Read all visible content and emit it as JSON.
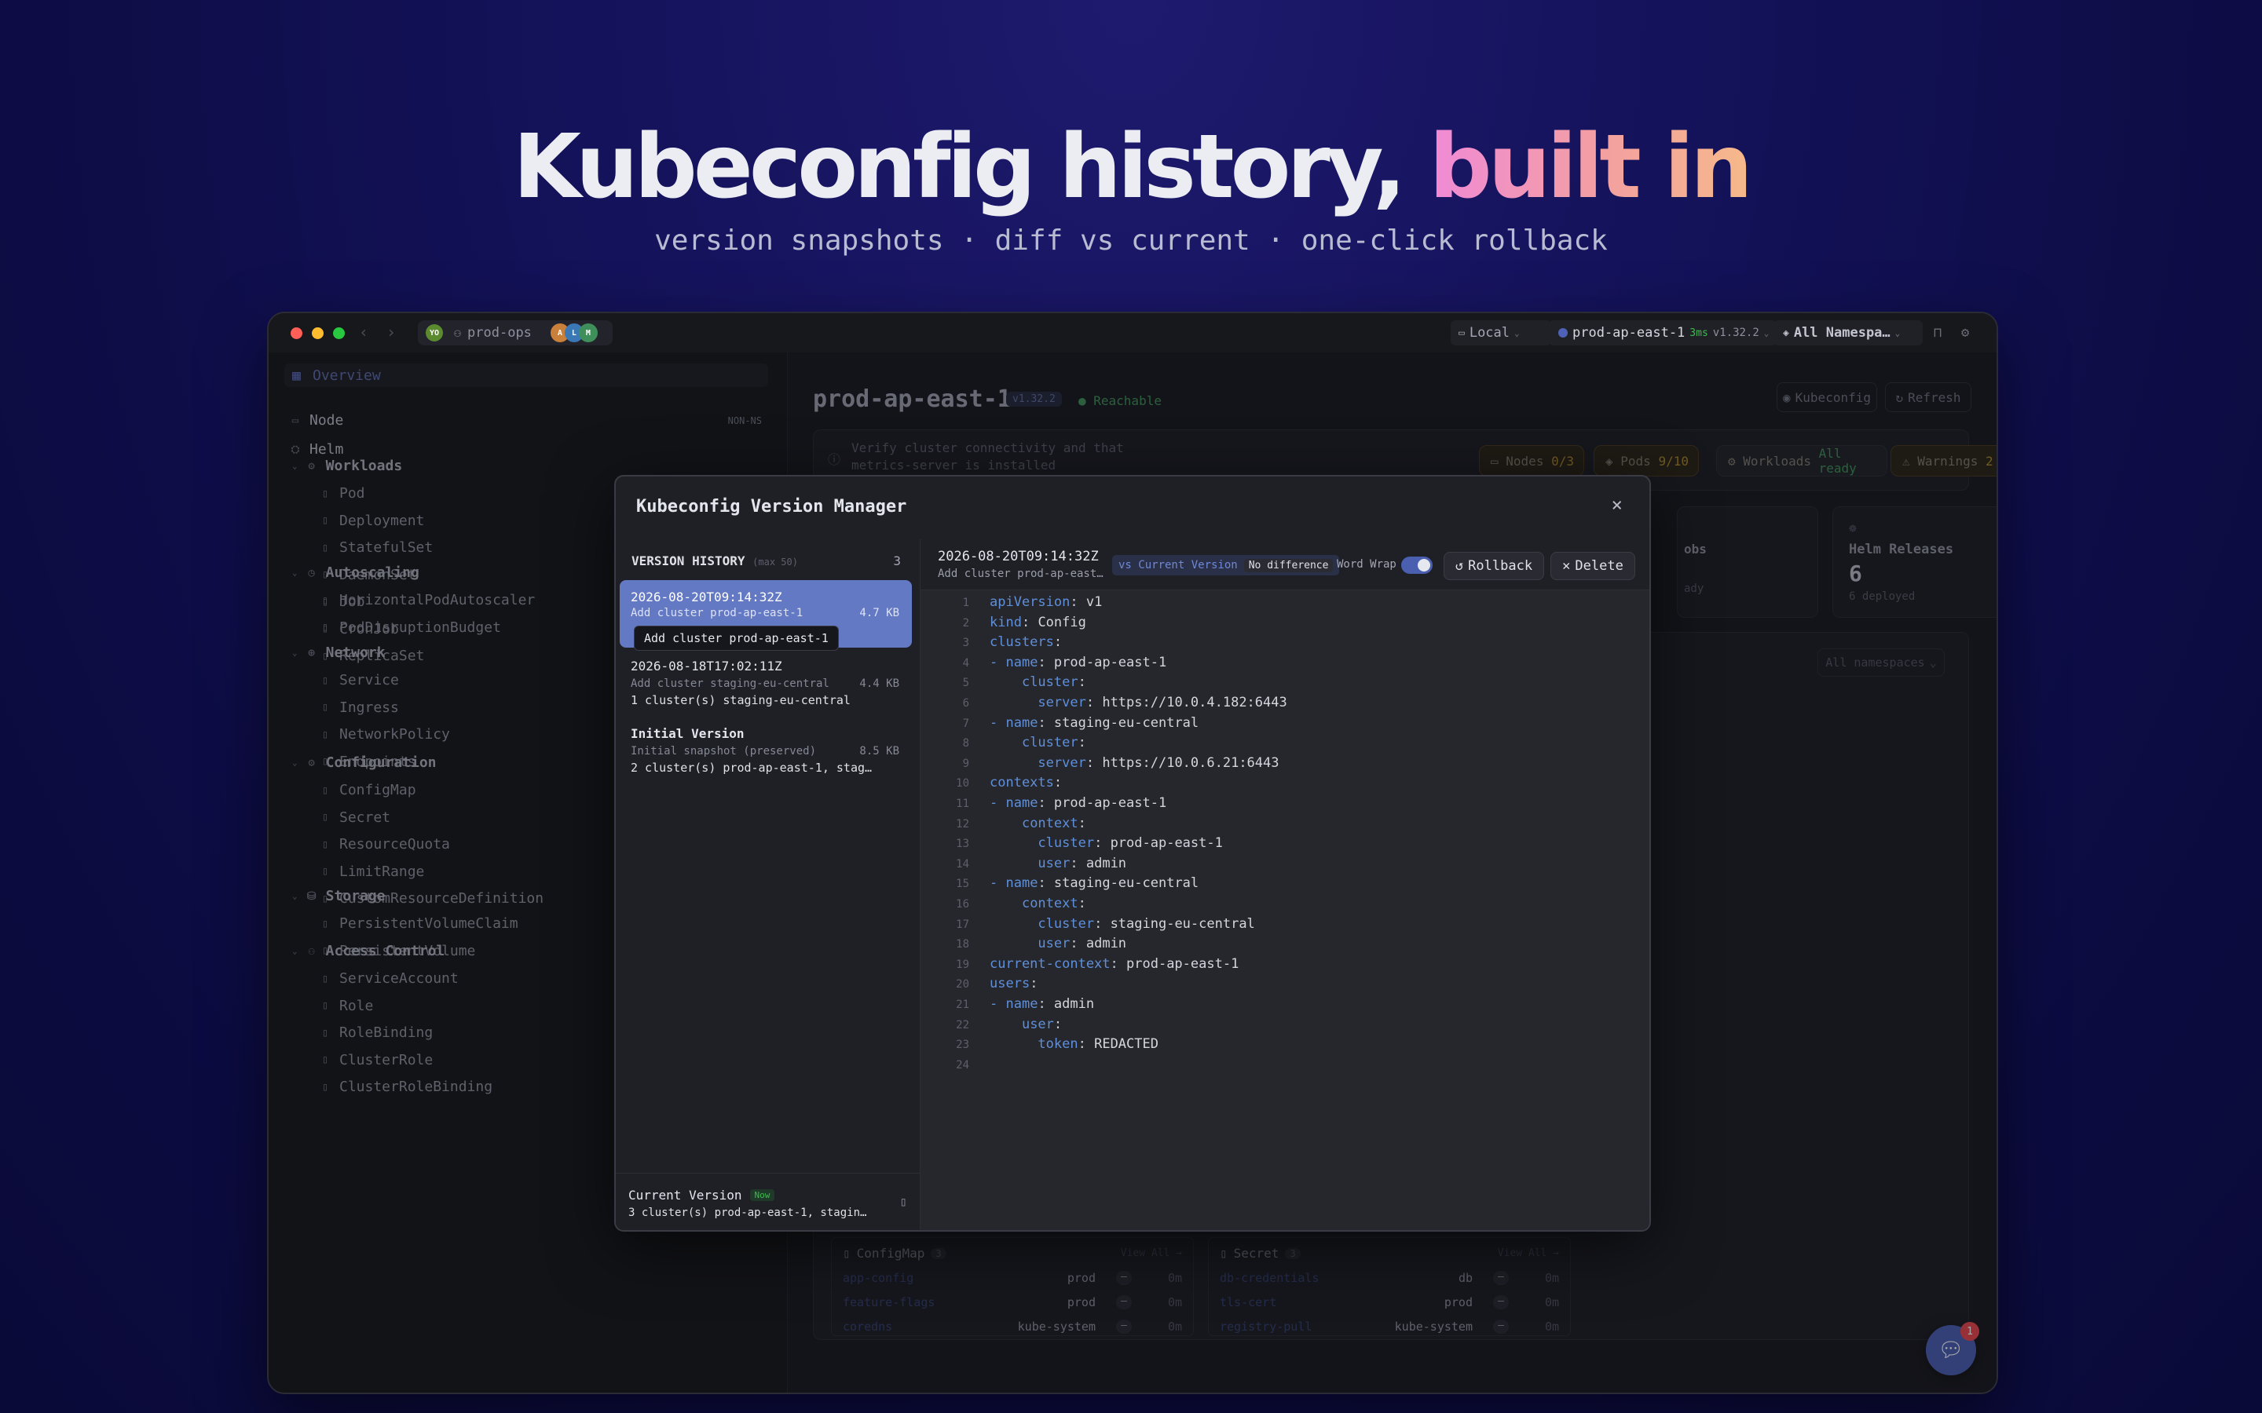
{
  "hero": {
    "title_main": "Kubeconfig history, ",
    "title_accent": "built in",
    "subtitle": "version snapshots · diff vs current · one-click rollback"
  },
  "titlebar": {
    "workspace": "prod-ops",
    "workspace_avatar": "YO",
    "env": "Local",
    "cluster": "prod-ap-east-1",
    "cluster_latency": "3ms",
    "cluster_version": "v1.32.2",
    "namespace": "All Namespa…"
  },
  "sidebar": {
    "overview": "Overview",
    "top_items": [
      {
        "label": "Node",
        "tag": "NON-NS"
      },
      {
        "label": "Helm",
        "tag": ""
      }
    ],
    "groups": [
      {
        "label": "Workloads",
        "items": [
          "Pod",
          "Deployment",
          "StatefulSet",
          "DaemonSet",
          "Job",
          "CronJob",
          "ReplicaSet"
        ]
      },
      {
        "label": "Autoscaling",
        "items": [
          "HorizontalPodAutoscaler",
          "PodDisruptionBudget"
        ]
      },
      {
        "label": "Network",
        "items": [
          "Service",
          "Ingress",
          "NetworkPolicy",
          "Endpoints"
        ]
      },
      {
        "label": "Configuration",
        "items": [
          "ConfigMap",
          "Secret",
          "ResourceQuota",
          "LimitRange",
          "CustomResourceDefinition"
        ]
      },
      {
        "label": "Storage",
        "items": [
          "PersistentVolumeClaim",
          "PersistentVolume"
        ]
      },
      {
        "label": "Access Control",
        "items": [
          "ServiceAccount",
          "Role",
          "RoleBinding",
          "ClusterRole",
          "ClusterRoleBinding"
        ]
      }
    ],
    "nonns_tag": "NON-NS"
  },
  "main": {
    "cluster_name": "prod-ap-east-1",
    "version_badge": "v1.32.2",
    "status": "Reachable",
    "kubeconfig_button": "Kubeconfig",
    "refresh_button": "Refresh",
    "notice": "Verify cluster connectivity and that metrics-server is installed",
    "chips": {
      "nodes_label": "Nodes",
      "nodes_value": "0/3",
      "pods_label": "Pods",
      "pods_value": "9/10",
      "workloads_label": "Workloads",
      "workloads_value": "All ready",
      "warnings_label": "Warnings",
      "warnings_value": "2"
    },
    "jobs_label": "obs",
    "jobs_sub": "ady",
    "helm": {
      "label": "Helm Releases",
      "value": "6",
      "sub": "6 deployed"
    },
    "ns_select": "All namespaces",
    "configmap": {
      "title": "ConfigMap",
      "count": "3",
      "view_all": "View All →",
      "rows": [
        {
          "name": "app-config",
          "ns": "prod",
          "dash": "—",
          "age": "0m"
        },
        {
          "name": "feature-flags",
          "ns": "prod",
          "dash": "—",
          "age": "0m"
        },
        {
          "name": "coredns",
          "ns": "kube-system",
          "dash": "—",
          "age": "0m"
        }
      ]
    },
    "secret": {
      "title": "Secret",
      "count": "3",
      "view_all": "View All →",
      "rows": [
        {
          "name": "db-credentials",
          "ns": "db",
          "dash": "—",
          "age": "0m"
        },
        {
          "name": "tls-cert",
          "ns": "prod",
          "dash": "—",
          "age": "0m"
        },
        {
          "name": "registry-pull",
          "ns": "kube-system",
          "dash": "—",
          "age": "0m"
        }
      ]
    },
    "chat_badge": "1"
  },
  "modal": {
    "title": "Kubeconfig Version Manager",
    "history_label": "VERSION HISTORY",
    "history_max": "(max 50)",
    "history_count": "3",
    "versions": [
      {
        "name": "2026-08-20T09:14:32Z",
        "desc": "Add cluster prod-ap-east-1",
        "size": "4.7 KB",
        "tooltip": "Add cluster prod-ap-east-1",
        "selected": true
      },
      {
        "name": "2026-08-18T17:02:11Z",
        "desc": "Add cluster staging-eu-central",
        "clusters": "1 cluster(s) staging-eu-central",
        "size": "4.4 KB"
      },
      {
        "name": "Initial Version",
        "desc": "Initial snapshot (preserved)",
        "clusters": "2 cluster(s) prod-ap-east-1, stag…",
        "size": "8.5 KB"
      }
    ],
    "current": {
      "label": "Current Version",
      "badge": "Now",
      "clusters": "3 cluster(s) prod-ap-east-1, stagin…"
    },
    "editor": {
      "version_name": "2026-08-20T09:14:32Z",
      "version_desc": "Add cluster prod-ap-east…",
      "vs_current": "vs Current Version",
      "diff_status": "No difference",
      "word_wrap": "Word Wrap",
      "word_wrap_on": true,
      "rollback": "Rollback",
      "delete": "Delete",
      "lines": [
        {
          "n": "1",
          "indent": 0,
          "dash": false,
          "key": "apiVersion",
          "val": "v1"
        },
        {
          "n": "2",
          "indent": 0,
          "dash": false,
          "key": "kind",
          "val": "Config"
        },
        {
          "n": "3",
          "indent": 0,
          "dash": false,
          "key": "clusters",
          "val": ""
        },
        {
          "n": "4",
          "indent": 1,
          "dash": true,
          "key": "name",
          "val": "prod-ap-east-1"
        },
        {
          "n": "5",
          "indent": 2,
          "dash": false,
          "key": "cluster",
          "val": ""
        },
        {
          "n": "6",
          "indent": 3,
          "dash": false,
          "key": "server",
          "val": "https://10.0.4.182:6443"
        },
        {
          "n": "7",
          "indent": 1,
          "dash": true,
          "key": "name",
          "val": "staging-eu-central"
        },
        {
          "n": "8",
          "indent": 2,
          "dash": false,
          "key": "cluster",
          "val": ""
        },
        {
          "n": "9",
          "indent": 3,
          "dash": false,
          "key": "server",
          "val": "https://10.0.6.21:6443"
        },
        {
          "n": "10",
          "indent": 0,
          "dash": false,
          "key": "contexts",
          "val": ""
        },
        {
          "n": "11",
          "indent": 1,
          "dash": true,
          "key": "name",
          "val": "prod-ap-east-1"
        },
        {
          "n": "12",
          "indent": 2,
          "dash": false,
          "key": "context",
          "val": ""
        },
        {
          "n": "13",
          "indent": 3,
          "dash": false,
          "key": "cluster",
          "val": "prod-ap-east-1"
        },
        {
          "n": "14",
          "indent": 3,
          "dash": false,
          "key": "user",
          "val": "admin"
        },
        {
          "n": "15",
          "indent": 1,
          "dash": true,
          "key": "name",
          "val": "staging-eu-central"
        },
        {
          "n": "16",
          "indent": 2,
          "dash": false,
          "key": "context",
          "val": ""
        },
        {
          "n": "17",
          "indent": 3,
          "dash": false,
          "key": "cluster",
          "val": "staging-eu-central"
        },
        {
          "n": "18",
          "indent": 3,
          "dash": false,
          "key": "user",
          "val": "admin"
        },
        {
          "n": "19",
          "indent": 0,
          "dash": false,
          "key": "current-context",
          "val": "prod-ap-east-1"
        },
        {
          "n": "20",
          "indent": 0,
          "dash": false,
          "key": "users",
          "val": ""
        },
        {
          "n": "21",
          "indent": 1,
          "dash": true,
          "key": "name",
          "val": "admin"
        },
        {
          "n": "22",
          "indent": 2,
          "dash": false,
          "key": "user",
          "val": ""
        },
        {
          "n": "23",
          "indent": 3,
          "dash": false,
          "key": "token",
          "val": "REDACTED"
        },
        {
          "n": "24",
          "indent": 0,
          "dash": false,
          "key": "",
          "val": ""
        }
      ]
    }
  },
  "colors": {
    "accent": "#5b73c9",
    "selected_version": "#6479c4",
    "green": "#3fb950",
    "amber": "#d4a017"
  }
}
